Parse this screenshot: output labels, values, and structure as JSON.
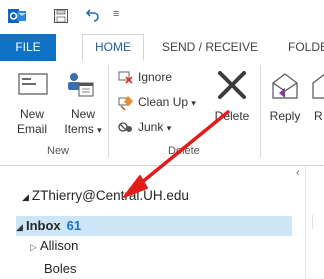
{
  "qat": {
    "app_icon": "outlook-icon",
    "save_icon": "save-icon",
    "undo_icon": "undo-icon",
    "more_label": "≡"
  },
  "tabs": [
    {
      "label": "FILE"
    },
    {
      "label": "HOME"
    },
    {
      "label": "SEND / RECEIVE"
    },
    {
      "label": "FOLDER"
    }
  ],
  "ribbon": {
    "new_email": {
      "line1": "New",
      "line2": "Email"
    },
    "new_items": {
      "line1": "New",
      "line2": "Items",
      "caret": "▾"
    },
    "group_new": "New",
    "ignore": "Ignore",
    "clean_up": "Clean Up",
    "clean_up_caret": "▾",
    "junk": "Junk",
    "junk_caret": "▾",
    "delete": "Delete",
    "group_delete": "Delete",
    "reply": "Reply",
    "reply_all_partial": "R"
  },
  "folder_pane": {
    "collapse": "‹",
    "account": "ZThierry@Central.UH.edu",
    "account_tri": "◢",
    "inbox": {
      "label": "Inbox",
      "count": "61",
      "tri": "◢"
    },
    "allison": {
      "label": "Allison",
      "tri": "▷"
    },
    "boles": {
      "label": "Boles"
    }
  },
  "colors": {
    "accent": "#1072c4",
    "selected_row": "#cde6f7",
    "annotation_arrow": "#e21b1b"
  }
}
